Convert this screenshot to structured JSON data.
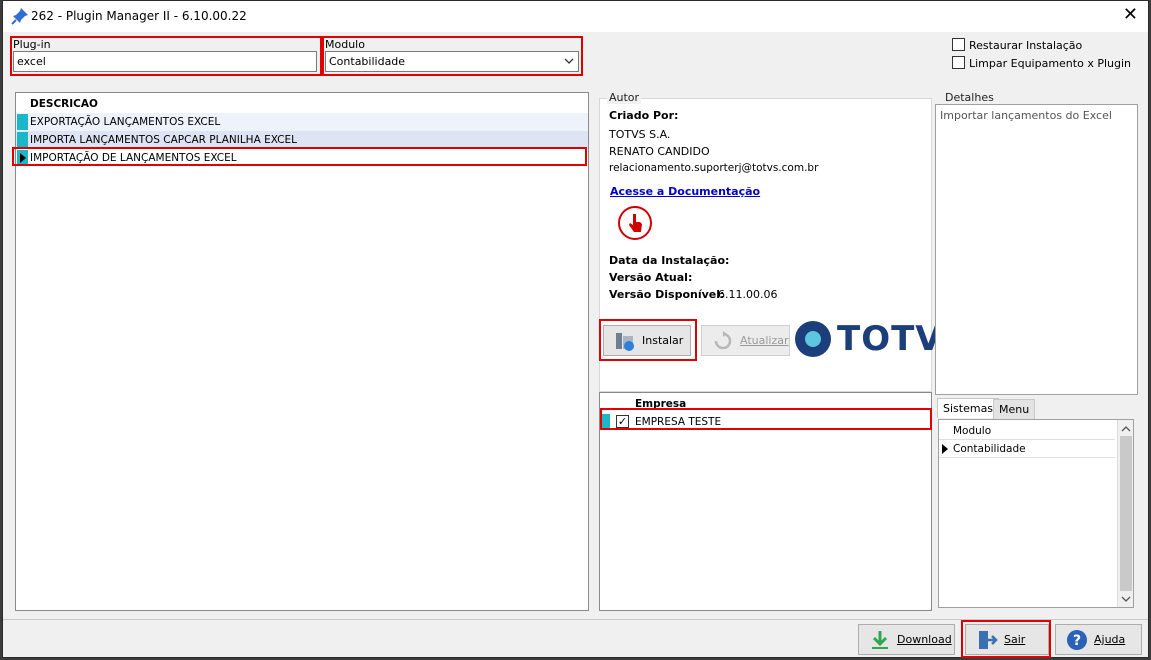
{
  "window": {
    "title": "262 - Plugin Manager II - 6.10.00.22"
  },
  "filters": {
    "plugin_label": "Plug-in",
    "plugin_value": "excel",
    "modulo_label": "Modulo",
    "modulo_value": "Contabilidade"
  },
  "options": {
    "restaurar_label": "Restaurar Instalação",
    "limpar_label": "Limpar Equipamento x Plugin"
  },
  "plugins_grid": {
    "header": "DESCRICAO",
    "rows": [
      "EXPORTAÇÃO LANÇAMENTOS EXCEL",
      "IMPORTA LANÇAMENTOS CAPCAR PLANILHA EXCEL",
      "IMPORTAÇÃO DE LANÇAMENTOS EXCEL"
    ]
  },
  "autor": {
    "group_label": "Autor",
    "criado_por_label": "Criado Por:",
    "company": "TOTVS S.A.",
    "author_name": "RENATO CANDIDO",
    "email": "relacionamento.suporterj@totvs.com.br",
    "doc_link": "Acesse a Documentação",
    "data_instalacao_label": "Data da Instalação:",
    "versao_atual_label": "Versão Atual:",
    "versao_disponivel_label": "Versão Disponível:",
    "versao_disponivel_value": "6.11.00.06"
  },
  "actions": {
    "instalar": "Instalar",
    "atualizar": "Atualizar",
    "logo_text": "TOTVS"
  },
  "empresa_grid": {
    "header": "Empresa",
    "rows": [
      "EMPRESA TESTE"
    ]
  },
  "detalhes": {
    "group_label": "Detalhes",
    "text": "Importar lançamentos do Excel"
  },
  "tabs": [
    "Sistemas",
    "Menu"
  ],
  "sistemas_grid": {
    "header": "Modulo",
    "rows": [
      "Contabilidade"
    ]
  },
  "footer": {
    "download": "Download",
    "sair": "Sair",
    "ajuda": "Ajuda"
  },
  "colors": {
    "highlight_red": "#e00000",
    "row_indicator": "#19b7c7",
    "link_blue": "#0000cc",
    "logo_blue": "#1c3e7a"
  }
}
